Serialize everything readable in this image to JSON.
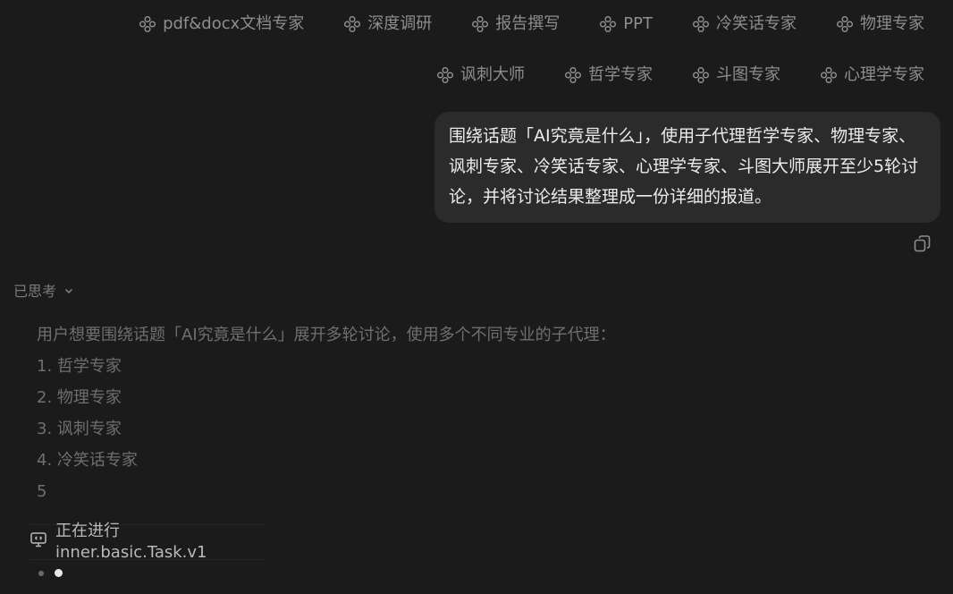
{
  "agents": {
    "row1": [
      {
        "label": "pdf&docx文档专家",
        "icon": "agent-icon"
      },
      {
        "label": "深度调研",
        "icon": "agent-icon"
      },
      {
        "label": "报告撰写",
        "icon": "agent-icon"
      },
      {
        "label": "PPT",
        "icon": "agent-icon"
      },
      {
        "label": "冷笑话专家",
        "icon": "agent-icon"
      },
      {
        "label": "物理专家",
        "icon": "agent-icon"
      }
    ],
    "row2": [
      {
        "label": "讽刺大师",
        "icon": "agent-icon"
      },
      {
        "label": "哲学专家",
        "icon": "agent-icon"
      },
      {
        "label": "斗图专家",
        "icon": "agent-icon"
      },
      {
        "label": "心理学专家",
        "icon": "agent-icon"
      }
    ]
  },
  "user_message": {
    "text": "围绕话题「AI究竟是什么」，使用子代理哲学专家、物理专家、讽刺专家、冷笑话专家、心理学专家、斗图大师展开至少5轮讨论，并将讨论结果整理成一份详细的报道。",
    "copy_icon": "copy-icon"
  },
  "thinking": {
    "label": "已思考",
    "chevron_icon": "chevron-down-icon",
    "lines": [
      "用户想要围绕话题「AI究竟是什么」展开多轮讨论，使用多个不同专业的子代理：",
      "1. 哲学专家",
      "2. 物理专家",
      "3. 讽刺专家",
      "4. 冷笑话专家",
      "5"
    ]
  },
  "task": {
    "icon": "monitor-icon",
    "status_text": "正在进行 inner.basic.Task.v1"
  },
  "colors": {
    "background": "#1b1b1b",
    "bubble": "#2b2b2b",
    "muted_text": "#8e8e8e",
    "thinking_text": "#6f6f6f"
  }
}
